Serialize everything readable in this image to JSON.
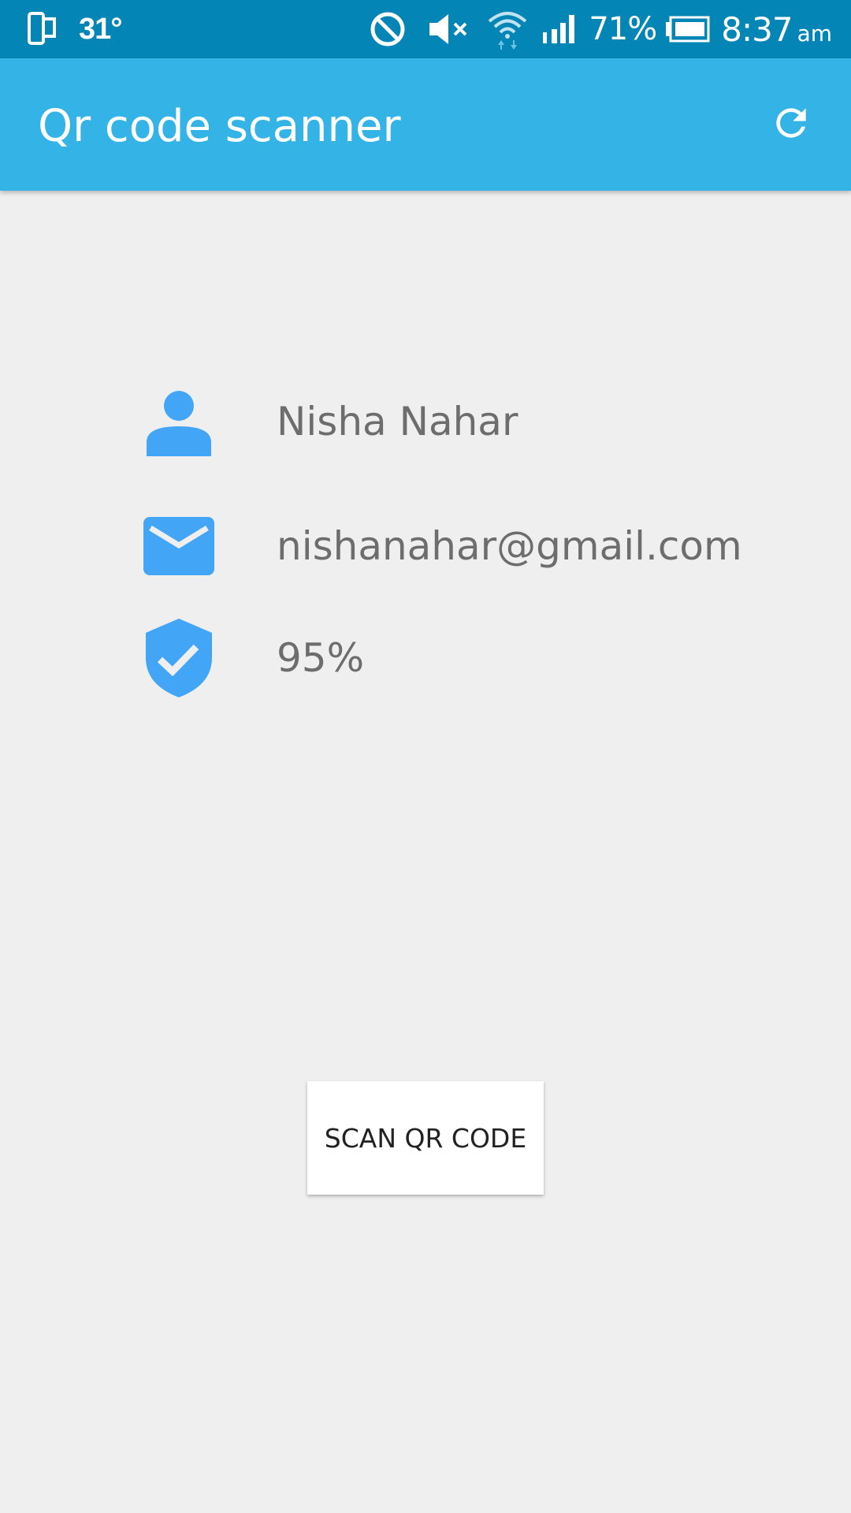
{
  "status_bar": {
    "temperature": "31°",
    "battery_percent": "71%",
    "time": "8:37",
    "am_pm": "am",
    "icons": [
      "phone-rotate-icon",
      "do-not-disturb-icon",
      "mute-icon",
      "wifi-icon",
      "signal-icon",
      "battery-icon"
    ]
  },
  "app_bar": {
    "title": "Qr code scanner",
    "action_icon": "refresh-icon",
    "color": "#34b4e6"
  },
  "profile": {
    "name": "Nisha Nahar",
    "email": "nishanahar@gmail.com",
    "score": "95%",
    "icons": [
      "person-icon",
      "email-icon",
      "verified-shield-icon"
    ],
    "icon_color": "#42a5f5"
  },
  "scan_button": {
    "label": "SCAN QR CODE"
  }
}
